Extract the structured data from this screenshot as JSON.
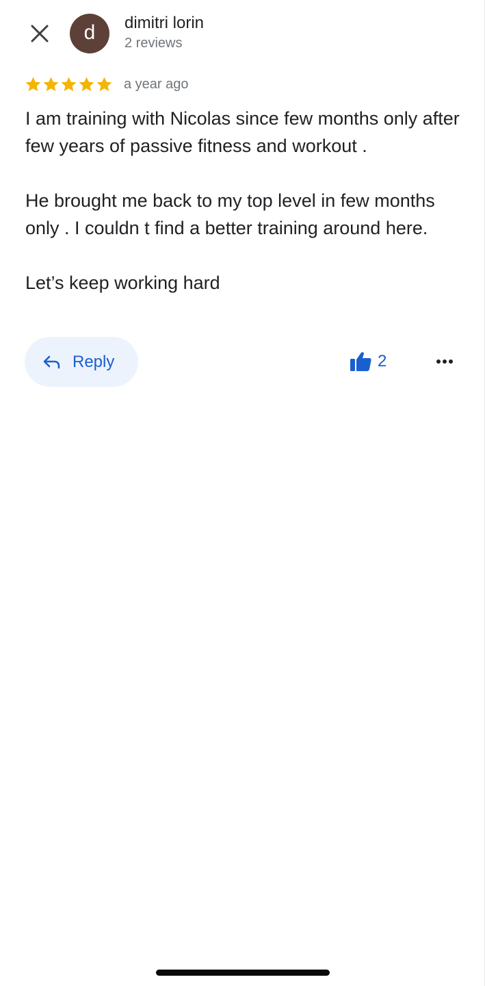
{
  "review": {
    "author_name": "dimitri lorin",
    "author_initial": "d",
    "review_count": "2 reviews",
    "rating": 5,
    "max_rating": 5,
    "time_ago": "a year ago",
    "paragraphs": [
      "I am training with Nicolas since few months only after few years of passive fitness and workout .",
      "He brought me back to my top level in few months only . I couldn t find a better training around here.",
      "Let’s keep working hard"
    ]
  },
  "actions": {
    "reply_label": "Reply",
    "like_count": "2"
  },
  "icons": {
    "close": "close-icon",
    "reply": "reply-arrow-icon",
    "like": "thumbs-up-icon",
    "more": "more-horizontal-icon",
    "star": "star-icon"
  },
  "colors": {
    "avatar_bg": "#5d4037",
    "star": "#f4b400",
    "accent": "#1a5fd0",
    "reply_bg": "#edf3fd",
    "secondary_text": "#70757a"
  }
}
